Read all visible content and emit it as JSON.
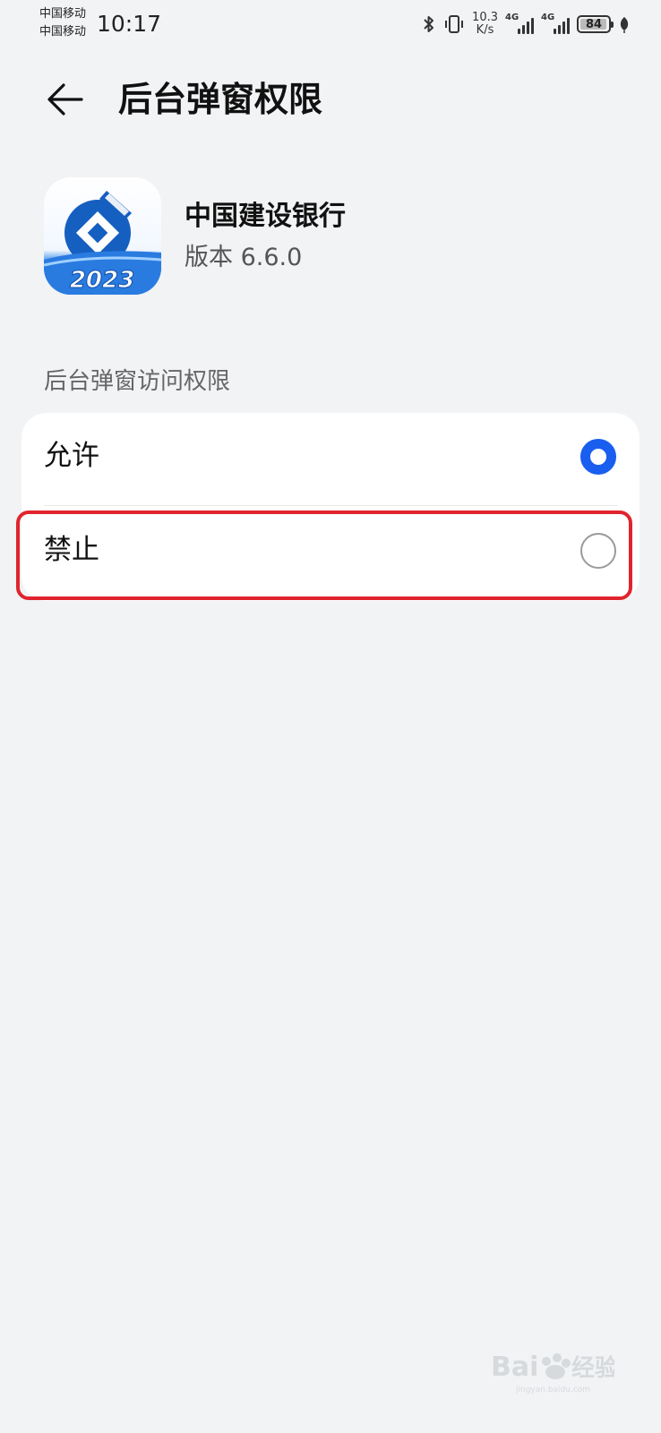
{
  "status_bar": {
    "carrier_1": "中国移动",
    "carrier_2": "中国移动",
    "time": "10:17",
    "net_speed_value": "10.3",
    "net_speed_unit": "K/s",
    "signal_1_tag": "4G",
    "signal_2_tag": "4G",
    "battery": "84",
    "icons": [
      "bluetooth-icon",
      "vibrate-icon",
      "signal-icon",
      "battery-icon",
      "leaf-icon"
    ]
  },
  "header": {
    "back_icon": "arrow-left-icon",
    "title": "后台弹窗权限"
  },
  "app": {
    "name": "中国建设银行",
    "version": "版本 6.6.0",
    "icon_badge_text": "2023",
    "icon_colors": {
      "primary": "#1b63c9",
      "logo": "#155fc0"
    }
  },
  "permission": {
    "section_title": "后台弹窗访问权限",
    "options": [
      {
        "label": "允许",
        "selected": true
      },
      {
        "label": "禁止",
        "selected": false
      }
    ],
    "highlighted_option": "禁止"
  },
  "colors": {
    "background": "#f1f3f5",
    "card": "#ffffff",
    "accent": "#1a5ef0",
    "highlight": "#e0242e"
  },
  "watermark": {
    "text": "Bai du 经验",
    "subtext": "jingyan.baidu.com"
  }
}
